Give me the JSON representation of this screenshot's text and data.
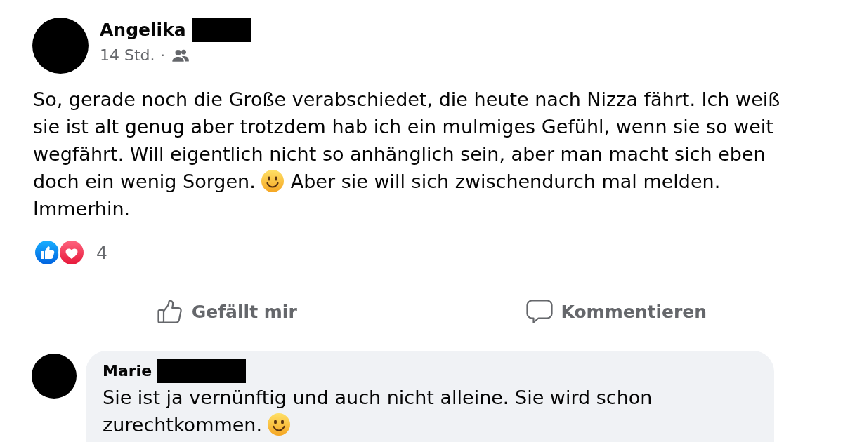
{
  "post": {
    "author": {
      "name": "Angelika",
      "surname_redacted": true
    },
    "time": "14 Std.",
    "separator": "·",
    "text_parts": [
      {
        "kind": "text",
        "text": "So, gerade noch die Große verabschiedet, die heute nach Nizza fährt. Ich weiß sie ist alt genug aber trotzdem hab ich ein mulmiges Gefühl, wenn sie so weit wegfährt. Will eigentlich nicht so anhänglich sein, aber man macht sich eben doch ein wenig Sorgen."
      },
      {
        "kind": "smiley"
      },
      {
        "kind": "text",
        "text": "Aber sie will sich zwischendurch mal melden. Immerhin."
      }
    ]
  },
  "reactions": {
    "icons": [
      {
        "kind": "like"
      },
      {
        "kind": "love"
      }
    ],
    "count": "4"
  },
  "actions": [
    {
      "kind": "like",
      "label": "Gefällt mir"
    },
    {
      "kind": "comment",
      "label": "Kommentieren"
    }
  ],
  "comments": [
    {
      "author": {
        "name": "Marie",
        "surname_redacted": true
      },
      "text_parts": [
        {
          "kind": "text",
          "text": "Sie ist ja vernünftig und auch nicht alleine. Sie wird schon zurechtkommen."
        },
        {
          "kind": "smiley"
        }
      ]
    }
  ]
}
